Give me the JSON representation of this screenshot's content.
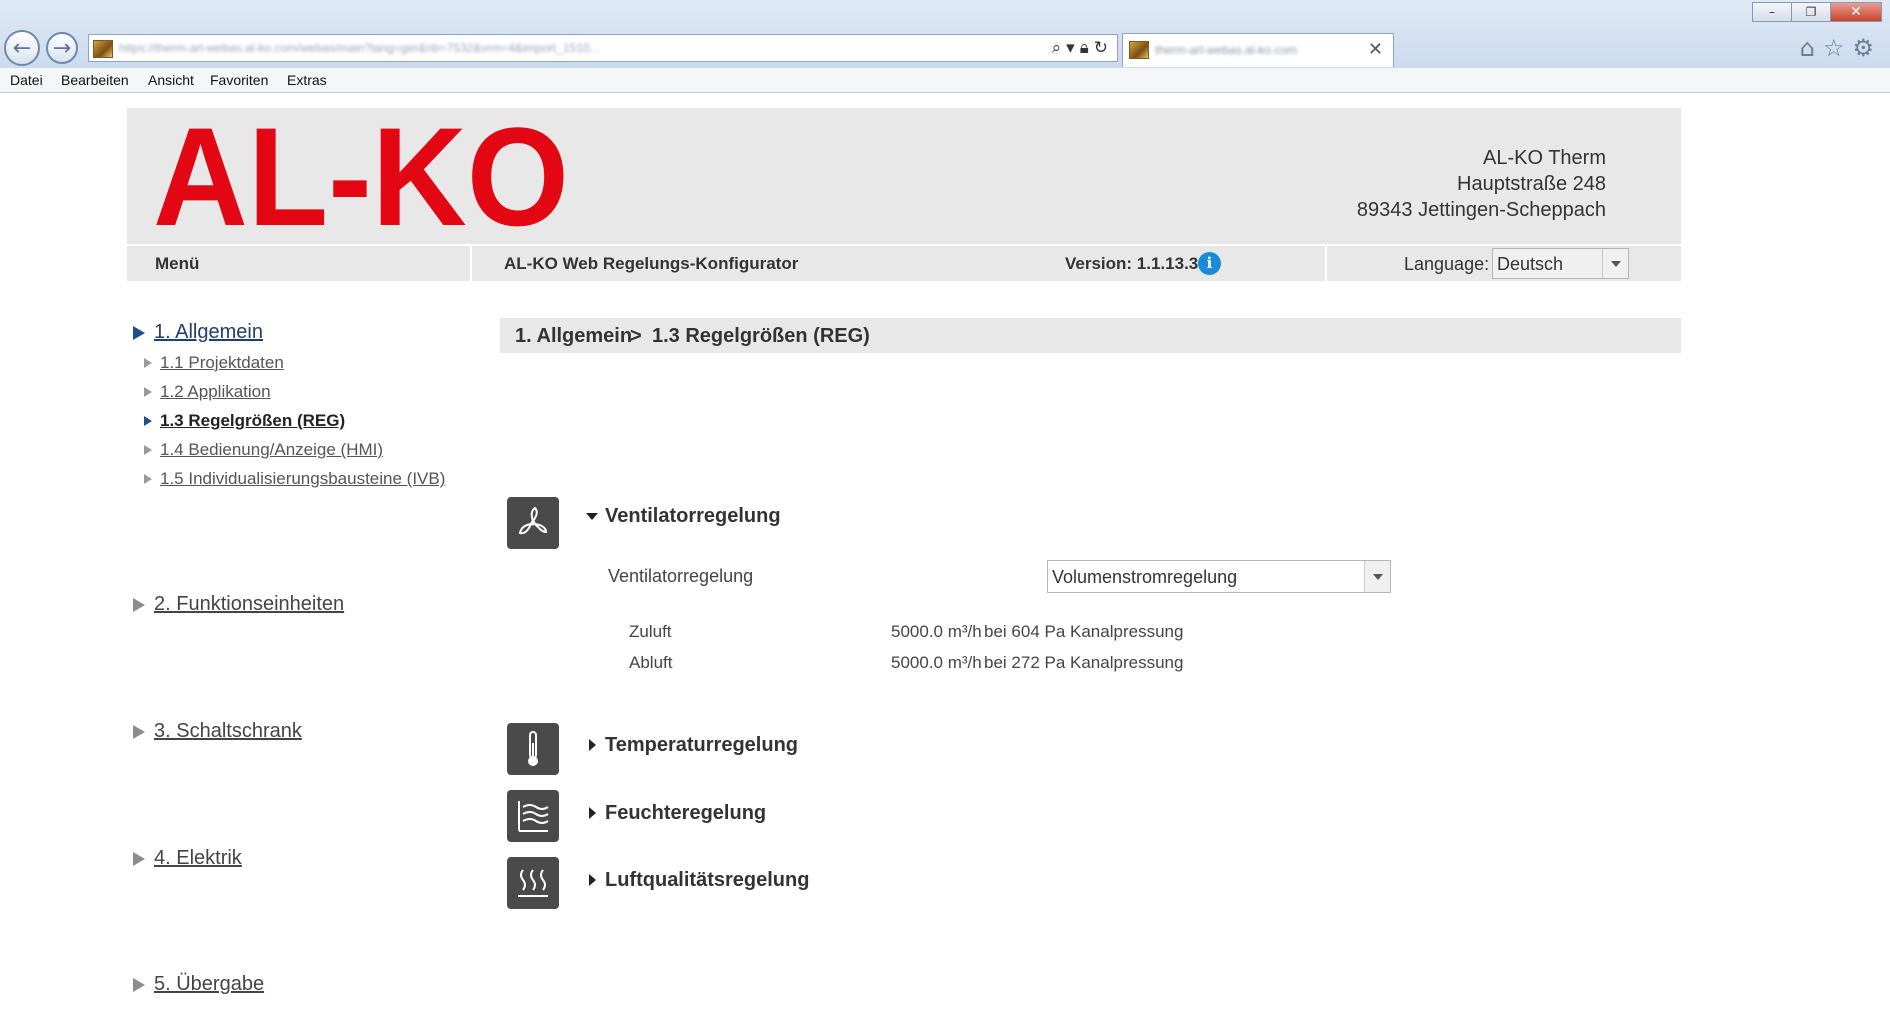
{
  "browser": {
    "url": "https://therm-arl-webas.al-ko.com/webas/main?lang=ger&nb=7532&vrm=4&import_1510...",
    "tab_title": "therm-arl-webas.al-ko.com",
    "menu": [
      "Datei",
      "Bearbeiten",
      "Ansicht",
      "Favoriten",
      "Extras"
    ]
  },
  "header": {
    "logo_text": "AL-KO",
    "company": "AL-KO Therm",
    "street": "Hauptstraße 248",
    "city": "89343 Jettingen-Scheppach",
    "brand_color": "#e30613"
  },
  "toolbar": {
    "menu_label": "Menü",
    "app_title": "AL-KO Web Regelungs-Konfigurator",
    "version": "Version: 1.1.13.3",
    "info_glyph": "i",
    "language_label": "Language:",
    "language_value": "Deutsch"
  },
  "sidebar": {
    "sections": [
      {
        "label": "1. Allgemein",
        "active": true
      },
      {
        "label": "2. Funktionseinheiten"
      },
      {
        "label": "3. Schaltschrank"
      },
      {
        "label": "4. Elektrik"
      },
      {
        "label": "5. Übergabe"
      }
    ],
    "subitems": [
      {
        "label": "1.1 Projektdaten"
      },
      {
        "label": "1.2 Applikation"
      },
      {
        "label": "1.3 Regelgrößen (REG)",
        "active": true
      },
      {
        "label": "1.4 Bedienung/Anzeige (HMI)"
      },
      {
        "label": "1.5 Individualisierungsbausteine (IVB)"
      }
    ]
  },
  "breadcrumb": {
    "part1": "1. Allgemein",
    "sep": ">",
    "part2": "1.3 Regelgrößen (REG)"
  },
  "main": {
    "ventilator": {
      "title": "Ventilatorregelung",
      "field_label": "Ventilatorregelung",
      "select_value": "Volumenstromregelung",
      "rows": [
        {
          "label": "Zuluft",
          "flow": "5000.0 m³/h",
          "pressure": "bei 604 Pa Kanalpressung"
        },
        {
          "label": "Abluft",
          "flow": "5000.0 m³/h",
          "pressure": "bei 272 Pa Kanalpressung"
        }
      ]
    },
    "temperatur": {
      "title": "Temperaturregelung"
    },
    "feuchte": {
      "title": "Feuchteregelung"
    },
    "luftqualitaet": {
      "title": "Luftqualitätsregelung"
    }
  }
}
